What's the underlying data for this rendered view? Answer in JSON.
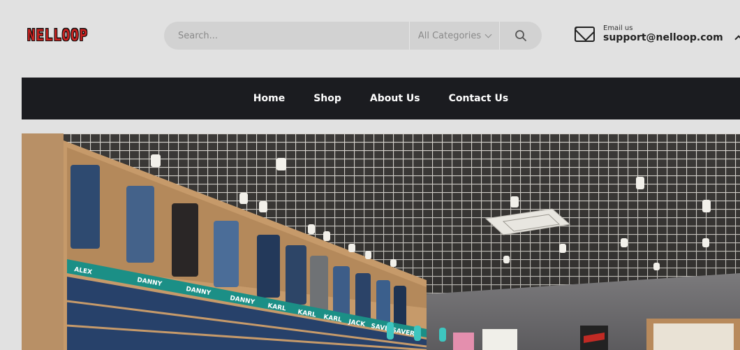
{
  "brand": {
    "logo_text": "NELLOOP"
  },
  "search": {
    "placeholder": "Search...",
    "category_label": "All Categories"
  },
  "contact": {
    "email_label": "Email us",
    "email_address": "support@nelloop.com"
  },
  "nav": {
    "items": [
      {
        "label": "Home"
      },
      {
        "label": "Shop"
      },
      {
        "label": "About Us"
      },
      {
        "label": "Contact Us"
      }
    ]
  },
  "hero": {
    "shelf_labels": [
      "ALEX",
      "DANNY",
      "DANNY",
      "DANNY",
      "KARL",
      "KARL",
      "KARL",
      "JACK",
      "SAVER",
      "SAVER"
    ]
  },
  "icons": [
    "search-icon",
    "mail-icon",
    "chevron-down-icon"
  ],
  "colors": {
    "nav_bg": "#1b1c20",
    "logo": "#c7211f",
    "shelf_label": "#1b8f86"
  }
}
